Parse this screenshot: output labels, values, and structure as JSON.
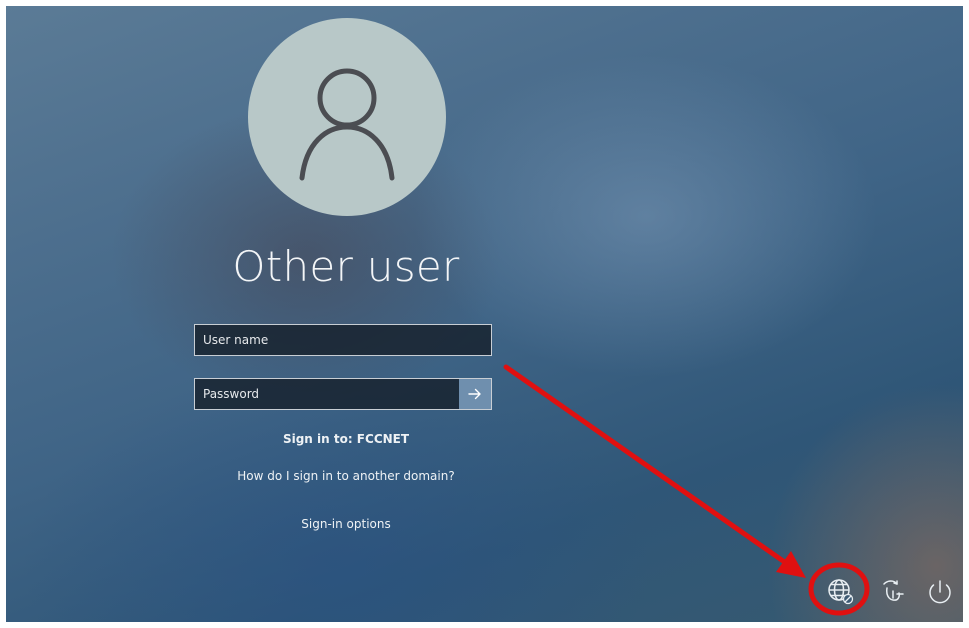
{
  "user": {
    "display_name": "Other user"
  },
  "login": {
    "username_placeholder": "User name",
    "password_placeholder": "Password",
    "submit_icon": "arrow-right-icon",
    "sign_in_to": "Sign in to: FCCNET",
    "domain_help_link": "How do I sign in to another domain?",
    "signin_options_link": "Sign-in options"
  },
  "tray": {
    "icons": [
      "network-globe-icon",
      "accessibility-icon",
      "power-icon"
    ]
  },
  "annotation": {
    "color": "#e01010",
    "marks": [
      "red-arrow",
      "red-circle-highlight"
    ]
  }
}
